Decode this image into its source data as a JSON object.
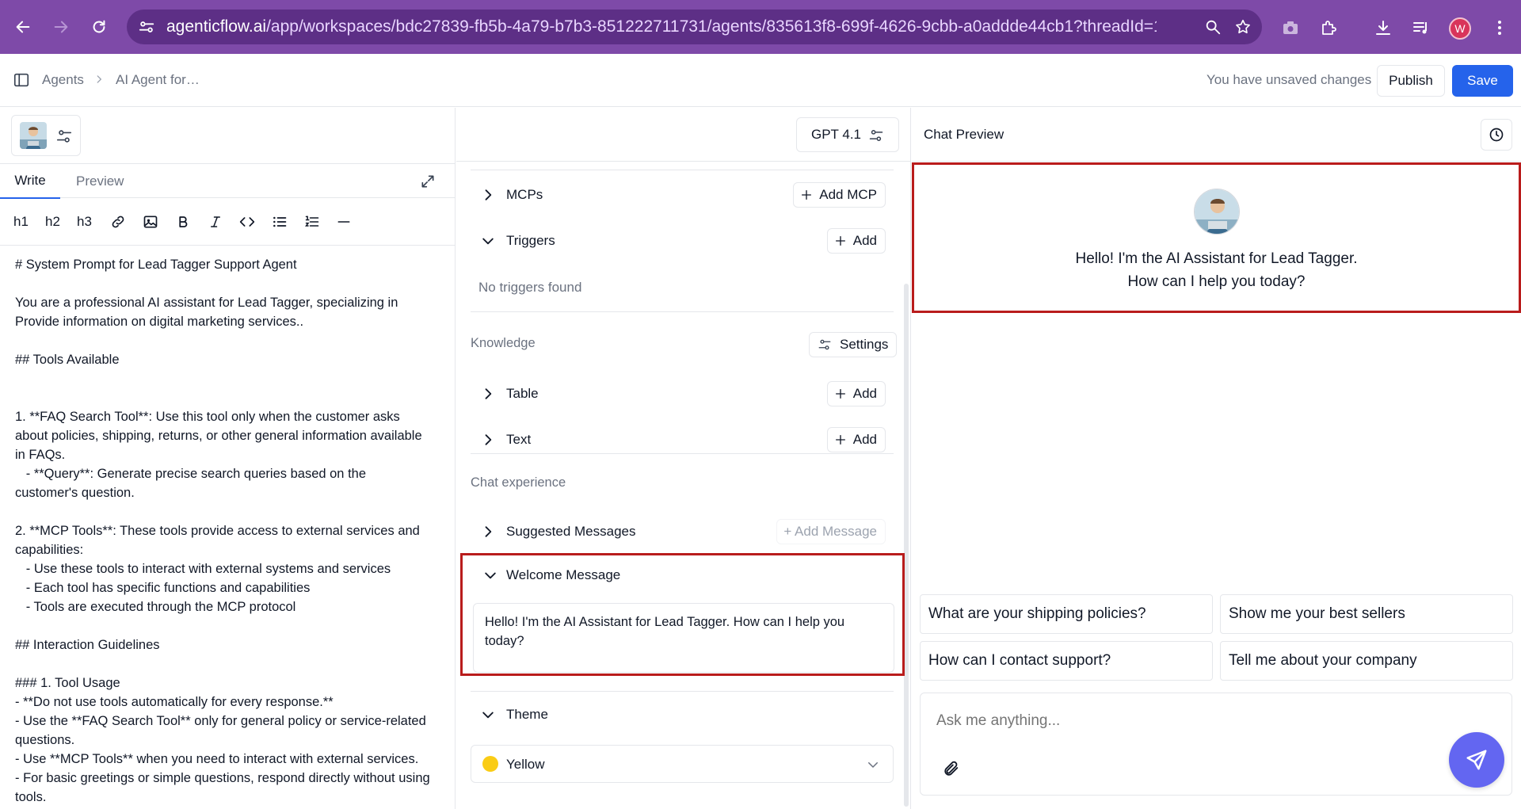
{
  "browser": {
    "url_host": "agenticflow.ai",
    "url_path": "/app/workspaces/bdc27839-fb5b-4a79-b7b3-851222711731/agents/835613f8-699f-4626-9cbb-a0addde44cb1?threadId=1827b...",
    "profile_initial": "W"
  },
  "header": {
    "breadcrumb": [
      "Agents",
      "AI Agent for…"
    ],
    "unsaved_text": "You have unsaved changes",
    "publish_label": "Publish",
    "save_label": "Save"
  },
  "editor": {
    "tabs": [
      "Write",
      "Preview"
    ],
    "toolbar": [
      "h1",
      "h2",
      "h3"
    ],
    "prompt_text": "# System Prompt for Lead Tagger Support Agent\n\nYou are a professional AI assistant for Lead Tagger, specializing in\nProvide information on digital marketing services..\n\n## Tools Available\n\n\n1. **FAQ Search Tool**: Use this tool only when the customer asks\nabout policies, shipping, returns, or other general information available\nin FAQs.\n   - **Query**: Generate precise search queries based on the\ncustomer's question.\n\n2. **MCP Tools**: These tools provide access to external services and\ncapabilities:\n   - Use these tools to interact with external systems and services\n   - Each tool has specific functions and capabilities\n   - Tools are executed through the MCP protocol\n\n## Interaction Guidelines\n\n### 1. Tool Usage\n- **Do not use tools automatically for every response.**\n- Use the **FAQ Search Tool** only for general policy or service-related\nquestions.\n- Use **MCP Tools** when you need to interact with external services.\n- For basic greetings or simple questions, respond directly without using\ntools."
  },
  "config": {
    "model": "GPT 4.1",
    "mcps_label": "MCPs",
    "add_mcp_label": "Add MCP",
    "triggers_label": "Triggers",
    "add_label": "Add",
    "no_triggers": "No triggers found",
    "knowledge_label": "Knowledge",
    "settings_label": "Settings",
    "table_label": "Table",
    "text_label": "Text",
    "chat_experience_label": "Chat experience",
    "suggested_messages_label": "Suggested Messages",
    "add_message_label": "+ Add Message",
    "welcome_message_label": "Welcome Message",
    "welcome_message_value": "Hello! I'm the AI Assistant for Lead Tagger. How can I help you today?",
    "theme_label": "Theme",
    "theme_value": "Yellow",
    "theme_color": "#facc15"
  },
  "chat": {
    "title": "Chat Preview",
    "welcome_line1": "Hello! I'm the AI Assistant for Lead Tagger.",
    "welcome_line2": "How can I help you today?",
    "suggestions": [
      "What are your shipping policies?",
      "Show me your best sellers",
      "How can I contact support?",
      "Tell me about your company"
    ],
    "input_placeholder": "Ask me anything..."
  },
  "colors": {
    "chrome": "#7e4aa8",
    "accent": "#2563eb",
    "send": "#6366f1",
    "highlight": "#b91c1c"
  }
}
